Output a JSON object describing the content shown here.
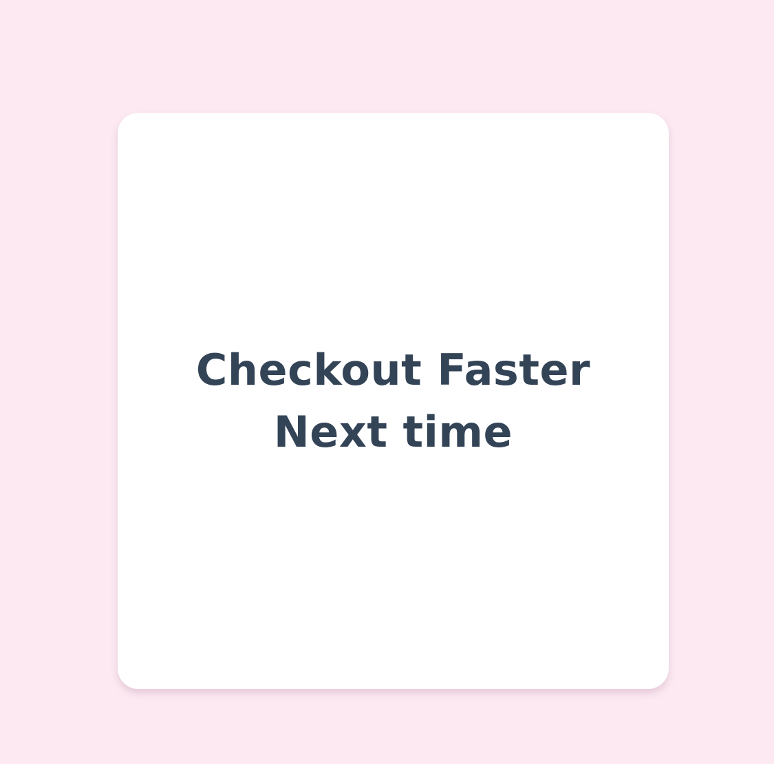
{
  "card": {
    "line1": "Checkout Faster",
    "line2": "Next time"
  },
  "colors": {
    "background": "#fce9f2",
    "card": "#ffffff",
    "text": "#344457"
  }
}
